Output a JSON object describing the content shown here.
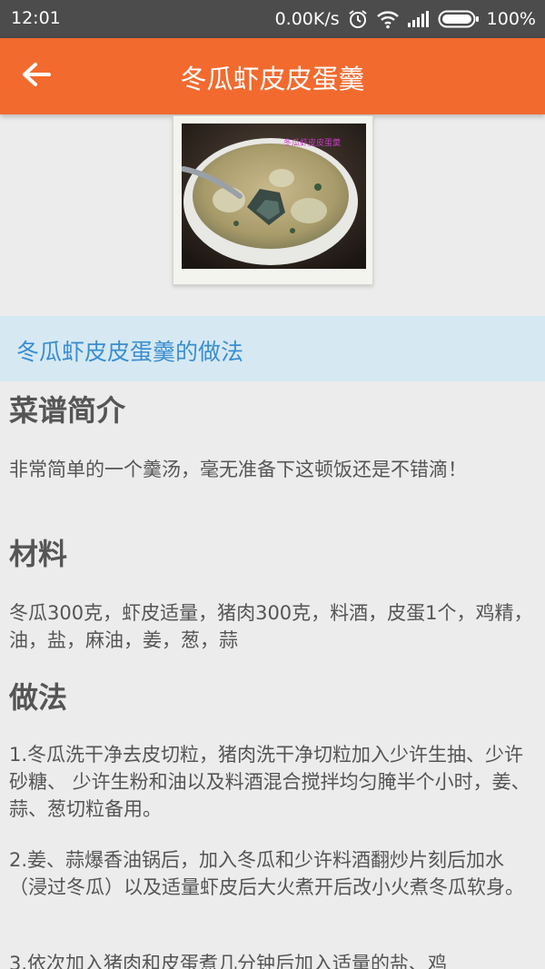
{
  "status_bar": {
    "time": "12:01",
    "network_speed": "0.00K/s",
    "battery": "100%",
    "icons": [
      "alarm-icon",
      "wifi-icon",
      "signal-icon",
      "battery-icon"
    ]
  },
  "app_bar": {
    "title": "冬瓜虾皮皮蛋羹",
    "back_icon": "arrow-left-icon",
    "color": "#f26a2e"
  },
  "photo": {
    "caption": "冬瓜虾皮皮蛋羹"
  },
  "banner": {
    "text": "冬瓜虾皮皮蛋羹的做法",
    "background": "#d6e9f3",
    "text_color": "#3b8ed0"
  },
  "intro": {
    "heading": "菜谱简介",
    "text": "非常简单的一个羹汤，毫无准备下这顿饭还是不错滴！"
  },
  "ingredients": {
    "heading": "材料",
    "text": "冬瓜300克，虾皮适量，猪肉300克，料酒，皮蛋1个，鸡精，油，盐，麻油，姜，葱，蒜"
  },
  "method": {
    "heading": "做法",
    "steps": [
      "1.冬瓜洗干净去皮切粒，猪肉洗干净切粒加入少许生抽、少许砂糖、 少许生粉和油以及料酒混合搅拌均匀腌半个小时，姜、蒜、葱切粒备用。",
      "2.姜、蒜爆香油锅后，加入冬瓜和少许料酒翻炒片刻后加水（浸过冬瓜）以及适量虾皮后大火煮开后改小火煮冬瓜软身。",
      "3.依次加入猪肉和皮蛋煮几分钟后加入适量的盐、鸡"
    ]
  }
}
